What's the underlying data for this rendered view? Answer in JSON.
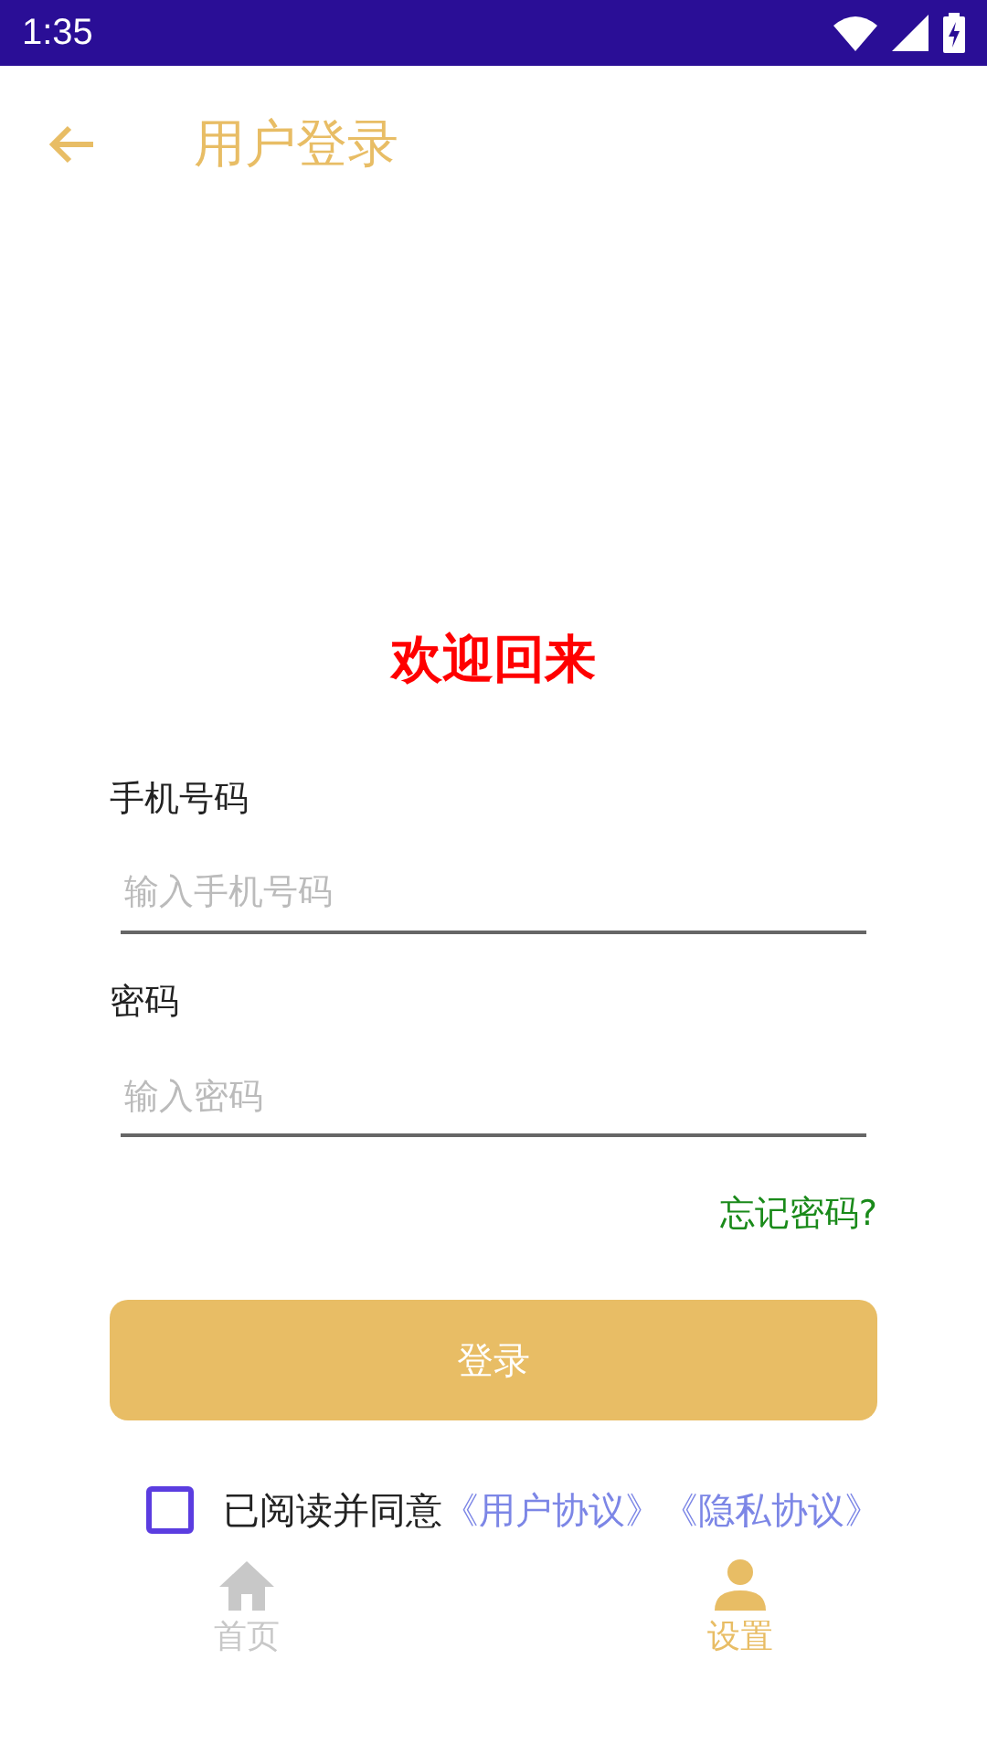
{
  "status_bar": {
    "time": "1:35"
  },
  "app_bar": {
    "title": "用户登录"
  },
  "welcome": "欢迎回来",
  "fields": [
    {
      "label": "手机号码",
      "placeholder": "输入手机号码"
    },
    {
      "label": "密码",
      "placeholder": "输入密码"
    }
  ],
  "forgot_link": "忘记密码?",
  "login_button": "登录",
  "agreement": {
    "checked": false,
    "text": "已阅读并同意",
    "links": [
      "《用户协议》",
      "《隐私协议》"
    ]
  },
  "bottom_nav": [
    {
      "label": "首页",
      "kind": "home",
      "selected": false
    },
    {
      "label": "设置",
      "kind": "person",
      "selected": true
    }
  ]
}
